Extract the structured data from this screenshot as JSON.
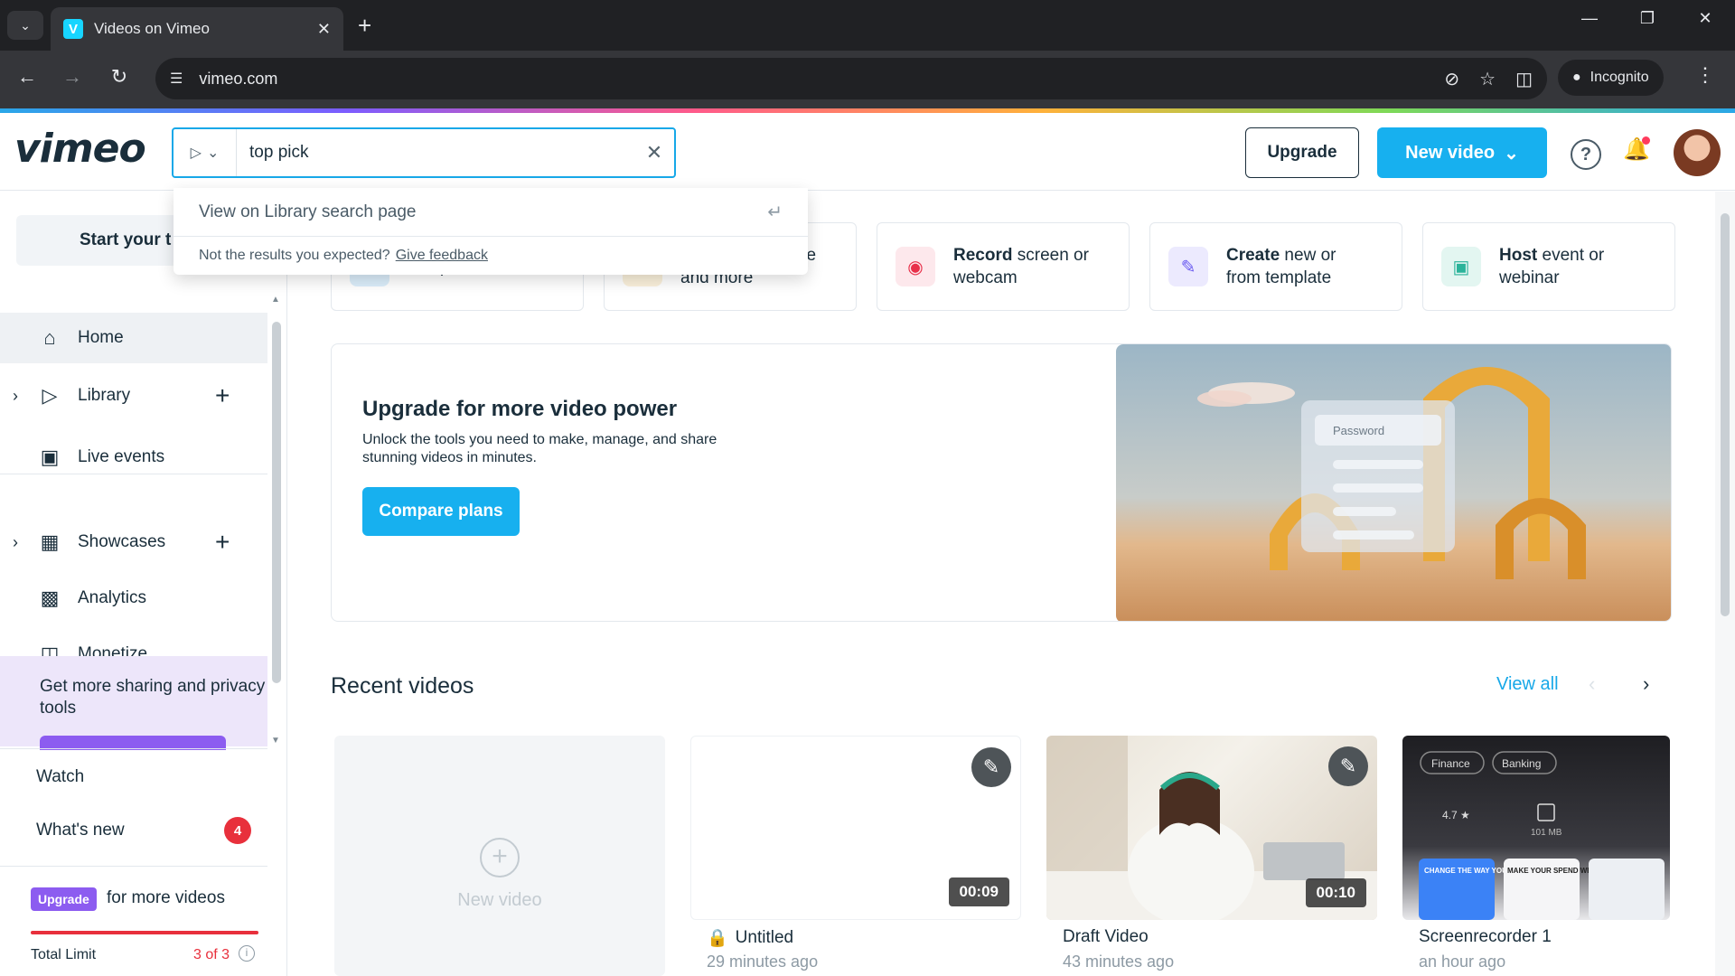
{
  "browser": {
    "tab_title": "Videos on Vimeo",
    "favicon_letter": "V",
    "url": "vimeo.com",
    "incognito_label": "Incognito"
  },
  "header": {
    "logo": "vimeo",
    "search_value": "top pick",
    "upgrade_label": "Upgrade",
    "new_video_label": "New video"
  },
  "search_dropdown": {
    "view_library": "View on Library search page",
    "not_expected": "Not the results you expected?",
    "feedback_link": "Give feedback"
  },
  "sidebar": {
    "start_trial": "Start your t",
    "items": [
      {
        "label": "Home",
        "icon": "home-icon"
      },
      {
        "label": "Library",
        "icon": "library-icon"
      },
      {
        "label": "Live events",
        "icon": "camera-icon"
      },
      {
        "label": "Showcases",
        "icon": "showcases-icon"
      },
      {
        "label": "Analytics",
        "icon": "analytics-icon"
      },
      {
        "label": "Monetize",
        "icon": "monetize-icon"
      }
    ],
    "promo_text": "Get more sharing and privacy tools",
    "watch": "Watch",
    "whats_new": "What's new",
    "whats_new_count": "4",
    "upgrade_pill": "Upgrade",
    "upgrade_text": "for more videos",
    "total_limit_label": "Total Limit",
    "total_limit_count": "3 of 3",
    "total_limit_fraction": 1.0
  },
  "quick_actions": [
    {
      "line1": "",
      "line2": "computer"
    },
    {
      "line1": "ve",
      "line2": "and more"
    },
    {
      "bold": "Record",
      "rest": " screen or",
      "line2": "webcam",
      "color": "#e8304a",
      "bg": "#fde8ec"
    },
    {
      "bold": "Create",
      "rest": " new or",
      "line2": "from template",
      "color": "#6b5cf0",
      "bg": "#eceafe"
    },
    {
      "bold": "Host",
      "rest": " event or",
      "line2": "webinar",
      "color": "#2bb39a",
      "bg": "#e3f6f1"
    }
  ],
  "banner": {
    "title": "Upgrade for more video power",
    "body": "Unlock the tools you need to make, manage, and share stunning videos in minutes.",
    "cta": "Compare plans",
    "art_password_label": "Password"
  },
  "recent": {
    "title": "Recent videos",
    "view_all": "View all",
    "new_video": "New video",
    "videos": [
      {
        "title": "Untitled",
        "time": "29 minutes ago",
        "duration": "00:09",
        "private": true
      },
      {
        "title": "Draft Video",
        "time": "43 minutes ago",
        "duration": "00:10",
        "private": false
      },
      {
        "title": "Screenrecorder 1",
        "time": "an hour ago",
        "duration": "",
        "private": false
      }
    ],
    "screen_tags": [
      "Finance",
      "Banking"
    ],
    "screen_rating": "4.7 ★",
    "screen_size": "101 MB",
    "screen_cards": [
      "CHANGE THE WAY YOU MONEY",
      "MAKE YOUR SPEND WELL-SPENT"
    ]
  },
  "colors": {
    "accent": "#17b0ef",
    "text": "#1a2e3b",
    "danger": "#e8303c",
    "purple": "#8c5cf0"
  }
}
